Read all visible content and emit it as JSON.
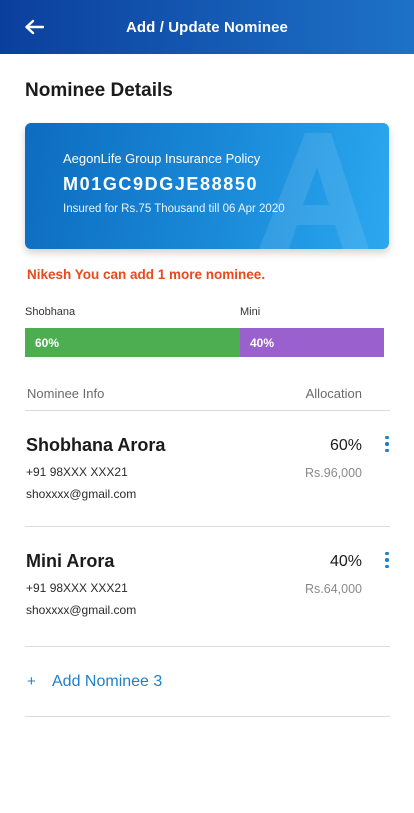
{
  "header": {
    "title": "Add / Update Nominee",
    "back_icon": "back-arrow-icon"
  },
  "section_title": "Nominee Details",
  "policy": {
    "name": "AegonLife Group Insurance Policy",
    "number": "M01GC9DGJE88850",
    "subtitle": "Insured for Rs.75 Thousand till 06 Apr 2020",
    "watermark_icon": "aegon-a-watermark"
  },
  "notice": "Nikesh You can add 1 more nominee.",
  "allocation_bar": {
    "segments": [
      {
        "name": "Shobhana",
        "percent_label": "60%",
        "fraction": 0.6,
        "color": "#4cae50"
      },
      {
        "name": "Mini",
        "percent_label": "40%",
        "fraction": 0.4,
        "color": "#9a60cd"
      }
    ]
  },
  "table": {
    "col_info": "Nominee Info",
    "col_allocation": "Allocation"
  },
  "nominees": [
    {
      "name": "Shobhana Arora",
      "phone": "+91 98XXX XXX21",
      "email": "shoxxxx@gmail.com",
      "percent": "60%",
      "amount": "Rs.96,000",
      "menu_icon": "more-vertical-icon"
    },
    {
      "name": "Mini Arora",
      "phone": "+91 98XXX XXX21",
      "email": "shoxxxx@gmail.com",
      "percent": "40%",
      "amount": "Rs.64,000",
      "menu_icon": "more-vertical-icon"
    }
  ],
  "add_nominee": {
    "plus": "+",
    "label": "Add Nominee 3"
  },
  "colors": {
    "accent": "#1f7fc9",
    "warning": "#e8491d",
    "header_start": "#0b3f9e",
    "header_end": "#1d72c7"
  }
}
